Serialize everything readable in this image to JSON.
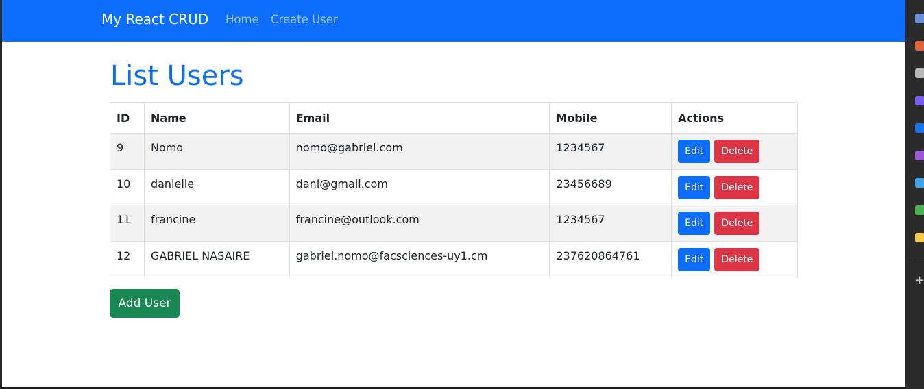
{
  "navbar": {
    "brand": "My React CRUD",
    "links": [
      "Home",
      "Create User"
    ]
  },
  "page": {
    "title": "List Users"
  },
  "table": {
    "headers": [
      "ID",
      "Name",
      "Email",
      "Mobile",
      "Actions"
    ],
    "rows": [
      {
        "id": "9",
        "name": "Nomo",
        "email": "nomo@gabriel.com",
        "mobile": "1234567"
      },
      {
        "id": "10",
        "name": "danielle",
        "email": "dani@gmail.com",
        "mobile": "23456689"
      },
      {
        "id": "11",
        "name": "francine",
        "email": "francine@outlook.com",
        "mobile": "1234567"
      },
      {
        "id": "12",
        "name": "GABRIEL NASAIRE",
        "email": "gabriel.nomo@facsciences-uy1.cm",
        "mobile": "237620864761"
      }
    ],
    "edit_label": "Edit",
    "delete_label": "Delete"
  },
  "add_button": "Add User",
  "sidebar_icons": [
    {
      "name": "tag-icon",
      "color": "#6a8fd8"
    },
    {
      "name": "toolbox-icon",
      "color": "#e0623a"
    },
    {
      "name": "chess-icon",
      "color": "#b8b8b8"
    },
    {
      "name": "copilot-icon",
      "color": "#7a5cf0"
    },
    {
      "name": "outlook-icon",
      "color": "#1a73e8"
    },
    {
      "name": "games-icon",
      "color": "#9b59d6"
    },
    {
      "name": "send-icon",
      "color": "#3fa4e8"
    },
    {
      "name": "tree-icon",
      "color": "#4caf50"
    },
    {
      "name": "drop-icon",
      "color": "#f2c94c"
    }
  ],
  "colors": {
    "primary": "#0d6efd",
    "danger": "#dc3545",
    "success": "#198754"
  }
}
